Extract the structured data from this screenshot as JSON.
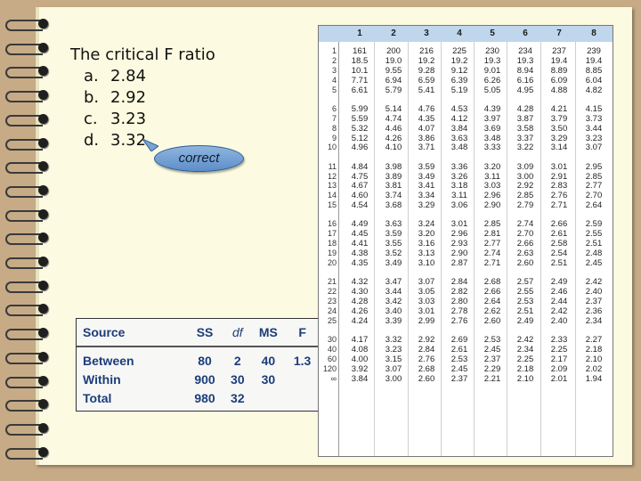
{
  "question": {
    "title": "The critical F ratio",
    "options": [
      {
        "letter": "a.",
        "value": "2.84"
      },
      {
        "letter": "b.",
        "value": "2.92"
      },
      {
        "letter": "c.",
        "value": "3.23"
      },
      {
        "letter": "d.",
        "value": "3.32"
      }
    ],
    "callout": "correct"
  },
  "anova": {
    "headers": [
      "Source",
      "SS",
      "df",
      "MS",
      "F"
    ],
    "rows": [
      [
        "Between",
        "80",
        "2",
        "40",
        "1.3"
      ],
      [
        "Within",
        "900",
        "30",
        "30",
        ""
      ],
      [
        "Total",
        "980",
        "32",
        "",
        ""
      ]
    ]
  },
  "f_table": {
    "columns": [
      "1",
      "2",
      "3",
      "4",
      "5",
      "6",
      "7",
      "8"
    ],
    "groups": [
      {
        "rows": [
          {
            "df": "1",
            "values": [
              "161",
              "200",
              "216",
              "225",
              "230",
              "234",
              "237",
              "239"
            ]
          },
          {
            "df": "2",
            "values": [
              "18.5",
              "19.0",
              "19.2",
              "19.2",
              "19.3",
              "19.3",
              "19.4",
              "19.4"
            ]
          },
          {
            "df": "3",
            "values": [
              "10.1",
              "9.55",
              "9.28",
              "9.12",
              "9.01",
              "8.94",
              "8.89",
              "8.85"
            ]
          },
          {
            "df": "4",
            "values": [
              "7.71",
              "6.94",
              "6.59",
              "6.39",
              "6.26",
              "6.16",
              "6.09",
              "6.04"
            ]
          },
          {
            "df": "5",
            "values": [
              "6.61",
              "5.79",
              "5.41",
              "5.19",
              "5.05",
              "4.95",
              "4.88",
              "4.82"
            ]
          }
        ]
      },
      {
        "rows": [
          {
            "df": "6",
            "values": [
              "5.99",
              "5.14",
              "4.76",
              "4.53",
              "4.39",
              "4.28",
              "4.21",
              "4.15"
            ]
          },
          {
            "df": "7",
            "values": [
              "5.59",
              "4.74",
              "4.35",
              "4.12",
              "3.97",
              "3.87",
              "3.79",
              "3.73"
            ]
          },
          {
            "df": "8",
            "values": [
              "5.32",
              "4.46",
              "4.07",
              "3.84",
              "3.69",
              "3.58",
              "3.50",
              "3.44"
            ]
          },
          {
            "df": "9",
            "values": [
              "5.12",
              "4.26",
              "3.86",
              "3.63",
              "3.48",
              "3.37",
              "3.29",
              "3.23"
            ]
          },
          {
            "df": "10",
            "values": [
              "4.96",
              "4.10",
              "3.71",
              "3.48",
              "3.33",
              "3.22",
              "3.14",
              "3.07"
            ]
          }
        ]
      },
      {
        "rows": [
          {
            "df": "11",
            "values": [
              "4.84",
              "3.98",
              "3.59",
              "3.36",
              "3.20",
              "3.09",
              "3.01",
              "2.95"
            ]
          },
          {
            "df": "12",
            "values": [
              "4.75",
              "3.89",
              "3.49",
              "3.26",
              "3.11",
              "3.00",
              "2.91",
              "2.85"
            ]
          },
          {
            "df": "13",
            "values": [
              "4.67",
              "3.81",
              "3.41",
              "3.18",
              "3.03",
              "2.92",
              "2.83",
              "2.77"
            ]
          },
          {
            "df": "14",
            "values": [
              "4.60",
              "3.74",
              "3.34",
              "3.11",
              "2.96",
              "2.85",
              "2.76",
              "2.70"
            ]
          },
          {
            "df": "15",
            "values": [
              "4.54",
              "3.68",
              "3.29",
              "3.06",
              "2.90",
              "2.79",
              "2.71",
              "2.64"
            ]
          }
        ]
      },
      {
        "rows": [
          {
            "df": "16",
            "values": [
              "4.49",
              "3.63",
              "3.24",
              "3.01",
              "2.85",
              "2.74",
              "2.66",
              "2.59"
            ]
          },
          {
            "df": "17",
            "values": [
              "4.45",
              "3.59",
              "3.20",
              "2.96",
              "2.81",
              "2.70",
              "2.61",
              "2.55"
            ]
          },
          {
            "df": "18",
            "values": [
              "4.41",
              "3.55",
              "3.16",
              "2.93",
              "2.77",
              "2.66",
              "2.58",
              "2.51"
            ]
          },
          {
            "df": "19",
            "values": [
              "4.38",
              "3.52",
              "3.13",
              "2.90",
              "2.74",
              "2.63",
              "2.54",
              "2.48"
            ]
          },
          {
            "df": "20",
            "values": [
              "4.35",
              "3.49",
              "3.10",
              "2.87",
              "2.71",
              "2.60",
              "2.51",
              "2.45"
            ]
          }
        ]
      },
      {
        "rows": [
          {
            "df": "21",
            "values": [
              "4.32",
              "3.47",
              "3.07",
              "2.84",
              "2.68",
              "2.57",
              "2.49",
              "2.42"
            ]
          },
          {
            "df": "22",
            "values": [
              "4.30",
              "3.44",
              "3.05",
              "2.82",
              "2.66",
              "2.55",
              "2.46",
              "2.40"
            ]
          },
          {
            "df": "23",
            "values": [
              "4.28",
              "3.42",
              "3.03",
              "2.80",
              "2.64",
              "2.53",
              "2.44",
              "2.37"
            ]
          },
          {
            "df": "24",
            "values": [
              "4.26",
              "3.40",
              "3.01",
              "2.78",
              "2.62",
              "2.51",
              "2.42",
              "2.36"
            ]
          },
          {
            "df": "25",
            "values": [
              "4.24",
              "3.39",
              "2.99",
              "2.76",
              "2.60",
              "2.49",
              "2.40",
              "2.34"
            ]
          }
        ]
      },
      {
        "rows": [
          {
            "df": "30",
            "values": [
              "4.17",
              "3.32",
              "2.92",
              "2.69",
              "2.53",
              "2.42",
              "2.33",
              "2.27"
            ]
          },
          {
            "df": "40",
            "values": [
              "4.08",
              "3.23",
              "2.84",
              "2.61",
              "2.45",
              "2.34",
              "2.25",
              "2.18"
            ]
          },
          {
            "df": "60",
            "values": [
              "4.00",
              "3.15",
              "2.76",
              "2.53",
              "2.37",
              "2.25",
              "2.17",
              "2.10"
            ]
          },
          {
            "df": "120",
            "values": [
              "3.92",
              "3.07",
              "2.68",
              "2.45",
              "2.29",
              "2.18",
              "2.09",
              "2.02"
            ]
          },
          {
            "df": "∞",
            "values": [
              "3.84",
              "3.00",
              "2.60",
              "2.37",
              "2.21",
              "2.10",
              "2.01",
              "1.94"
            ]
          }
        ]
      }
    ]
  }
}
